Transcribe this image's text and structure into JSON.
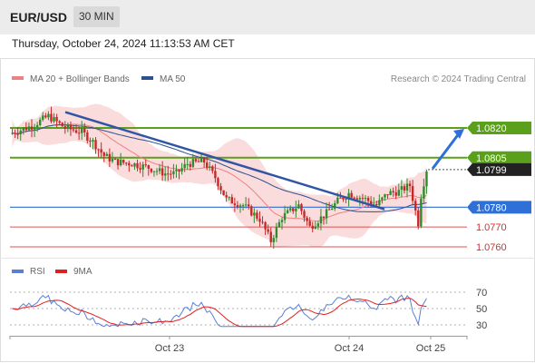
{
  "header": {
    "symbol": "EUR/USD",
    "timeframe": "30 MIN"
  },
  "datetime": "Thursday, October 24, 2024 11:13:53 AM CET",
  "legend_main": [
    {
      "label": "MA 20 + Bollinger Bands",
      "color": "#f08080"
    },
    {
      "label": "MA 50",
      "color": "#2f4f8f"
    }
  ],
  "legend_rsi": [
    {
      "label": "RSI",
      "color": "#5b7fd6"
    },
    {
      "label": "9MA",
      "color": "#e02020"
    }
  ],
  "credit": "Research © 2024 Trading Central",
  "colors": {
    "bull": "#2e8b2e",
    "bear": "#c62828",
    "resistance": "#5aa01a",
    "pivot": "#2e6fd8",
    "support": "#e05050",
    "trend": "#2f55a4",
    "bands": "#f9d3d3"
  },
  "chart_data": [
    {
      "type": "candlestick",
      "title": "EUR/USD 30 MIN",
      "ylim": [
        1.0756,
        1.0845
      ],
      "levels": [
        {
          "value": 1.082,
          "label": "1.0820",
          "kind": "resistance"
        },
        {
          "value": 1.0805,
          "label": "1.0805",
          "kind": "resistance"
        },
        {
          "value": 1.0799,
          "label": "1.0799",
          "kind": "last"
        },
        {
          "value": 1.078,
          "label": "1.0780",
          "kind": "pivot"
        },
        {
          "value": 1.077,
          "label": "1.0770",
          "kind": "support"
        },
        {
          "value": 1.076,
          "label": "1.0760",
          "kind": "support"
        }
      ],
      "x_ticks": [
        "Oct 23",
        "Oct 24",
        "Oct 25"
      ],
      "trendline": {
        "from": 1.0828,
        "to": 1.0779
      },
      "arrow": {
        "from": 1.0799,
        "to": 1.082
      }
    },
    {
      "type": "line",
      "title": "RSI",
      "ylim": [
        20,
        80
      ],
      "y_ticks": [
        70,
        50,
        30
      ],
      "series": [
        {
          "name": "RSI"
        },
        {
          "name": "9MA"
        }
      ]
    }
  ]
}
